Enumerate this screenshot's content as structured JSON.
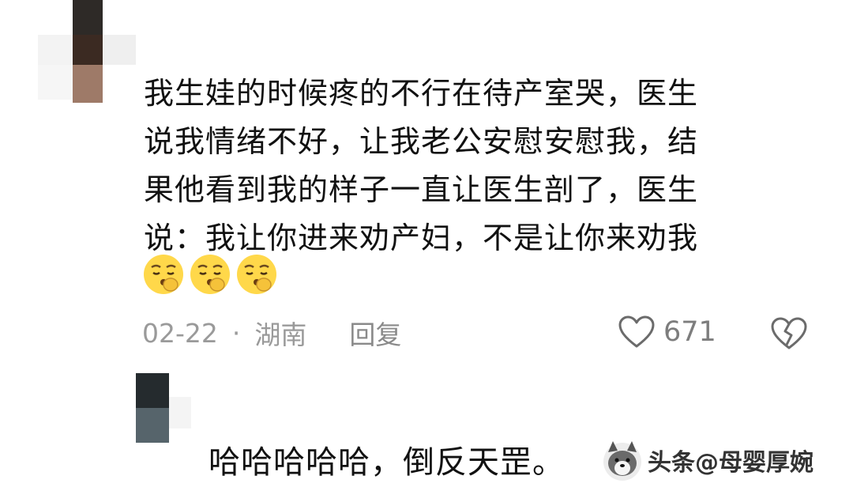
{
  "comment": {
    "text_lines": [
      "我生娃的时候疼的不行在待产室哭，医生",
      "说我情绪不好，让我老公安慰安慰我，结",
      "果他看到我的样子一直让医生剖了，医生",
      "说：我让你进来劝产妇，不是让你来劝我"
    ],
    "emoji_names": [
      "sad-face-emoji",
      "sad-face-emoji",
      "sad-face-emoji"
    ],
    "date": "02-22",
    "separator": "·",
    "location": "湖南",
    "reply_label": "回复",
    "like_count": "671"
  },
  "reply": {
    "text": "哈哈哈哈哈，倒反天罡。"
  },
  "watermark": {
    "text": "头条@母婴厚婉"
  },
  "colors": {
    "text": "#111111",
    "meta": "#9a9a9a",
    "icon_stroke": "#6b6b6b",
    "emoji_fill": "#ffd84a"
  }
}
